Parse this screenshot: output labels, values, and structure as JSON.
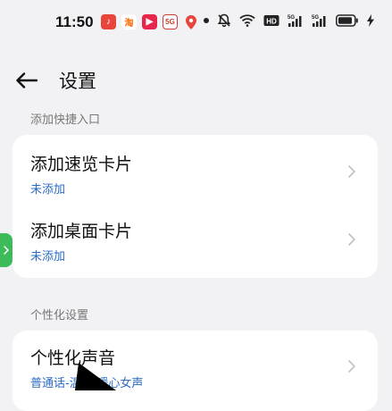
{
  "status_bar": {
    "time": "11:50",
    "apps": [
      {
        "name": "music-app-icon",
        "glyph": "♪",
        "color": "#e8453c"
      },
      {
        "name": "taobao-icon",
        "glyph": "淘",
        "color": "#ff6a00"
      },
      {
        "name": "video-app-icon",
        "glyph": "▶",
        "color": "#e8254a"
      },
      {
        "name": "game-app-icon",
        "glyph": "5G",
        "color": "#d43a2f"
      },
      {
        "name": "map-pin-app-icon",
        "glyph": "●",
        "color": "#e8453c"
      }
    ],
    "battery_level": 0.75
  },
  "header": {
    "title": "设置"
  },
  "sections": {
    "shortcut_label": "添加快捷入口",
    "personal_label": "个性化设置"
  },
  "rows": {
    "quick_card_title": "添加速览卡片",
    "quick_card_status": "未添加",
    "desktop_card_title": "添加桌面卡片",
    "desktop_card_status": "未添加",
    "voice_title": "个性化声音",
    "voice_value": "普通话-温暖-暖心女声"
  },
  "colors": {
    "link_blue": "#2a6cc6",
    "side_tab_green": "#3dbb5a",
    "background": "#f2f2f4"
  }
}
